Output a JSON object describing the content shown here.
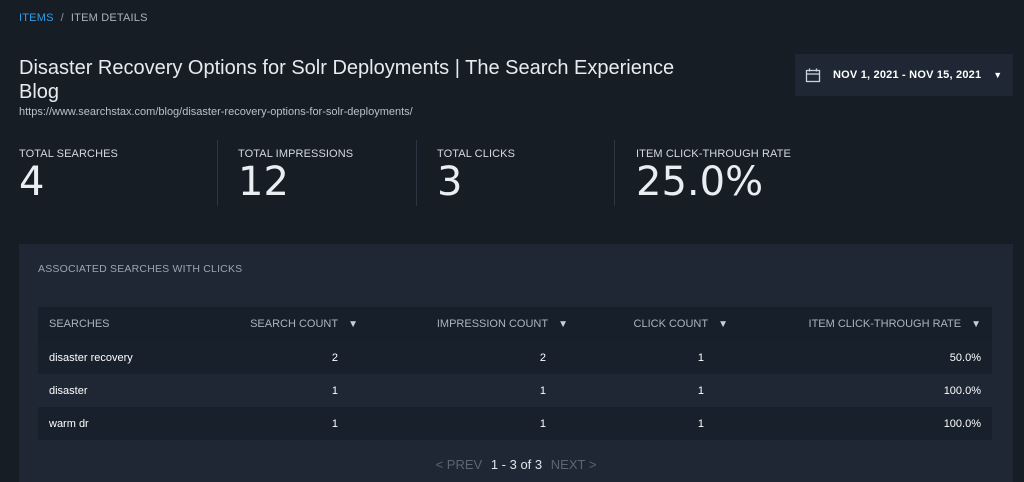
{
  "breadcrumb": {
    "items_label": "ITEMS",
    "separator": "/",
    "current": "ITEM DETAILS"
  },
  "page": {
    "title": "Disaster Recovery Options for Solr Deployments | The Search Experience Blog",
    "url": "https://www.searchstax.com/blog/disaster-recovery-options-for-solr-deployments/"
  },
  "date_range": {
    "label": "NOV 1, 2021 - NOV 15, 2021",
    "icon": "calendar-icon",
    "caret": "▼"
  },
  "metrics": [
    {
      "label": "TOTAL SEARCHES",
      "value": "4"
    },
    {
      "label": "TOTAL IMPRESSIONS",
      "value": "12"
    },
    {
      "label": "TOTAL CLICKS",
      "value": "3"
    },
    {
      "label": "ITEM CLICK-THROUGH RATE",
      "value": "25.0%"
    }
  ],
  "table": {
    "title": "ASSOCIATED SEARCHES WITH CLICKS",
    "columns": [
      "SEARCHES",
      "SEARCH COUNT",
      "IMPRESSION COUNT",
      "CLICK COUNT",
      "ITEM CLICK-THROUGH RATE"
    ],
    "sort_glyph": "▼",
    "rows": [
      {
        "search": "disaster recovery",
        "search_count": "2",
        "impression_count": "2",
        "click_count": "1",
        "ctr": "50.0%"
      },
      {
        "search": "disaster",
        "search_count": "1",
        "impression_count": "1",
        "click_count": "1",
        "ctr": "100.0%"
      },
      {
        "search": "warm dr",
        "search_count": "1",
        "impression_count": "1",
        "click_count": "1",
        "ctr": "100.0%"
      }
    ]
  },
  "pagination": {
    "prev": "< PREV",
    "range": "1 - 3 of 3",
    "next": "NEXT >"
  },
  "colors": {
    "background": "#171d25",
    "panel": "#1e2733",
    "link": "#2f9ee8"
  }
}
